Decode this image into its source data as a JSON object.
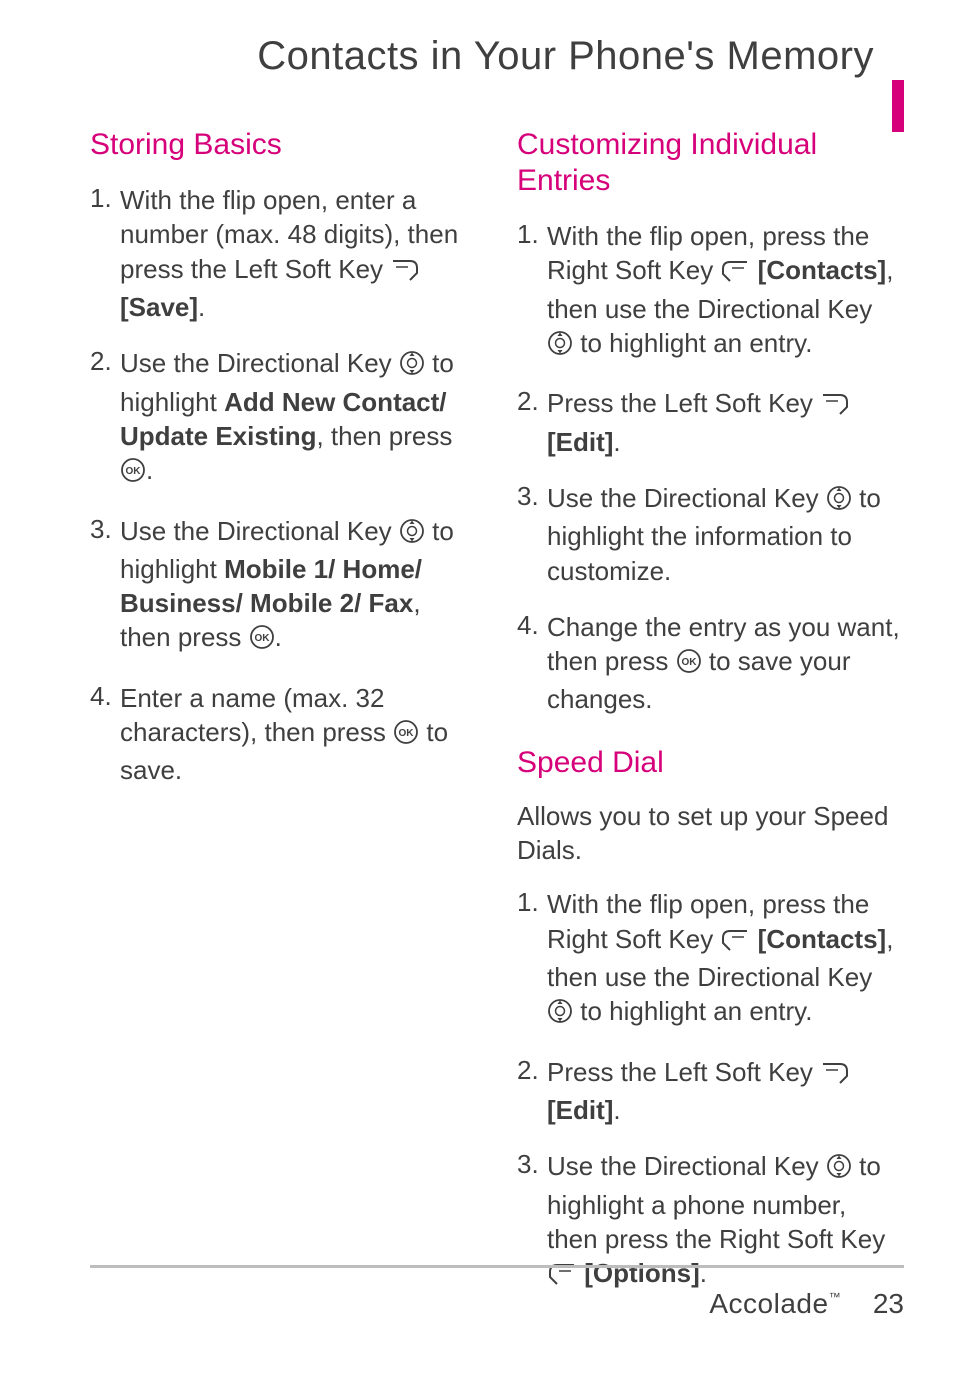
{
  "title": "Contacts in Your Phone's Memory",
  "left": {
    "heading": "Storing Basics",
    "steps": [
      {
        "n": "1.",
        "parts": [
          {
            "t": "With the flip open, enter a number (max. 48 digits), then press the Left Soft Key "
          },
          {
            "icon": "left-soft-key"
          },
          {
            "t": " "
          },
          {
            "bold": "[Save]"
          },
          {
            "t": "."
          }
        ]
      },
      {
        "n": "2.",
        "parts": [
          {
            "t": "Use the Directional Key "
          },
          {
            "icon": "dpad"
          },
          {
            "t": " to highlight "
          },
          {
            "bold": "Add New Contact/ Update Existing"
          },
          {
            "t": ", then press "
          },
          {
            "icon": "ok"
          },
          {
            "t": "."
          }
        ]
      },
      {
        "n": "3.",
        "parts": [
          {
            "t": "Use the Directional Key "
          },
          {
            "icon": "dpad"
          },
          {
            "t": " to highlight "
          },
          {
            "bold": "Mobile 1/ Home/ Business/ Mobile 2/ Fax"
          },
          {
            "t": ", then press "
          },
          {
            "icon": "ok"
          },
          {
            "t": "."
          }
        ]
      },
      {
        "n": "4.",
        "parts": [
          {
            "t": "Enter a name (max. 32 characters), then press "
          },
          {
            "icon": "ok"
          },
          {
            "t": " to save."
          }
        ]
      }
    ]
  },
  "right": {
    "heading1": "Customizing Individual Entries",
    "steps1": [
      {
        "n": "1.",
        "parts": [
          {
            "t": "With the flip open, press the Right Soft Key "
          },
          {
            "icon": "right-soft-key"
          },
          {
            "t": " "
          },
          {
            "bold": "[Contacts]"
          },
          {
            "t": ", then use the Directional Key "
          },
          {
            "icon": "dpad"
          },
          {
            "t": " to highlight an entry."
          }
        ]
      },
      {
        "n": "2.",
        "parts": [
          {
            "t": "Press the Left Soft Key "
          },
          {
            "icon": "left-soft-key"
          },
          {
            "t": " "
          },
          {
            "bold": "[Edit]"
          },
          {
            "t": "."
          }
        ]
      },
      {
        "n": "3.",
        "parts": [
          {
            "t": "Use the Directional Key "
          },
          {
            "icon": "dpad"
          },
          {
            "t": " to highlight the information to customize."
          }
        ]
      },
      {
        "n": "4.",
        "parts": [
          {
            "t": "Change the entry as you want, then press "
          },
          {
            "icon": "ok"
          },
          {
            "t": " to save your changes."
          }
        ]
      }
    ],
    "heading2": "Speed Dial",
    "para2": "Allows you to set up your Speed Dials.",
    "steps2": [
      {
        "n": "1.",
        "parts": [
          {
            "t": "With the flip open, press the Right Soft Key "
          },
          {
            "icon": "right-soft-key"
          },
          {
            "t": " "
          },
          {
            "bold": "[Contacts]"
          },
          {
            "t": ", then use the Directional Key "
          },
          {
            "icon": "dpad"
          },
          {
            "t": " to highlight an entry."
          }
        ]
      },
      {
        "n": "2.",
        "parts": [
          {
            "t": "Press the Left Soft Key "
          },
          {
            "icon": "left-soft-key"
          },
          {
            "t": " "
          },
          {
            "bold": "[Edit]"
          },
          {
            "t": "."
          }
        ]
      },
      {
        "n": "3.",
        "parts": [
          {
            "t": "Use the Directional Key "
          },
          {
            "icon": "dpad"
          },
          {
            "t": " to highlight a phone number, then press the Right Soft Key "
          },
          {
            "icon": "right-soft-key"
          },
          {
            "t": " "
          },
          {
            "bold": "[Options]"
          },
          {
            "t": "."
          }
        ]
      }
    ]
  },
  "footer": {
    "brand": "Accolade",
    "tm": "™",
    "page": "23"
  },
  "icons": {
    "left-soft-key": "left-soft-key-icon",
    "right-soft-key": "right-soft-key-icon",
    "dpad": "dpad-icon",
    "ok": "ok-icon"
  }
}
